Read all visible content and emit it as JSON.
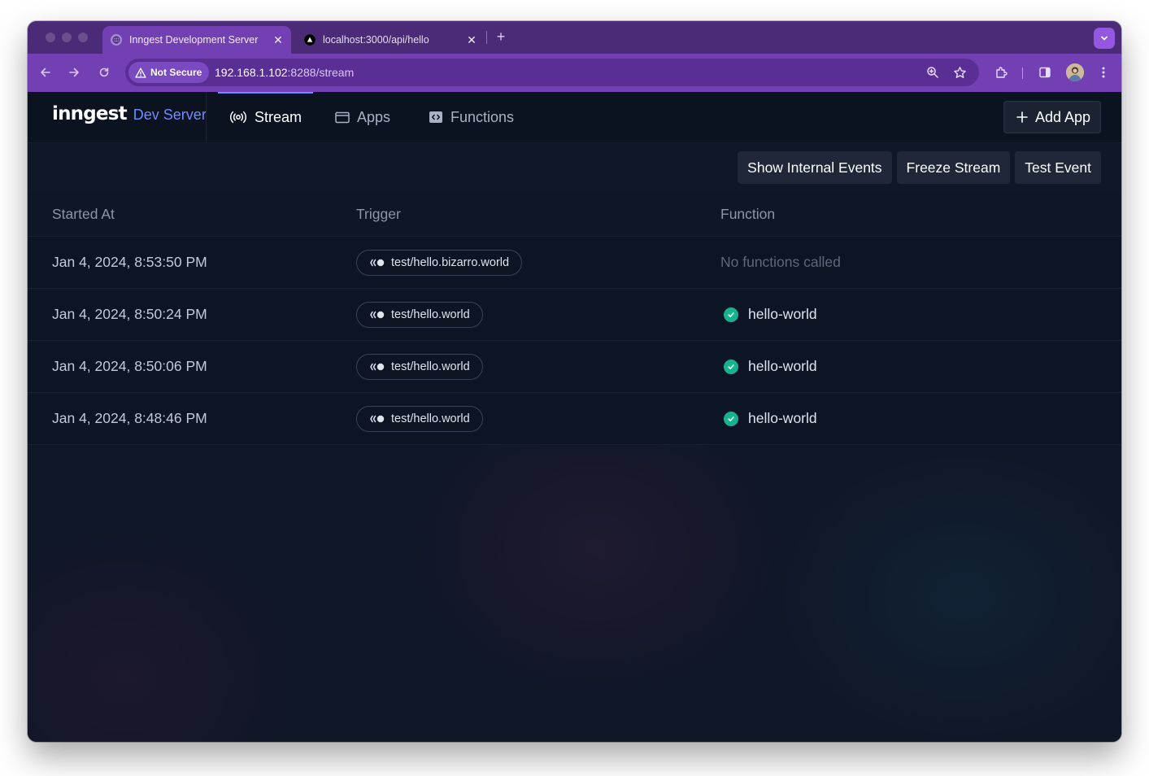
{
  "browser": {
    "tabs": [
      {
        "title": "Inngest Development Server",
        "active": true,
        "favicon": "globe-icon"
      },
      {
        "title": "localhost:3000/api/hello",
        "active": false,
        "favicon": "vercel-triangle-icon"
      }
    ],
    "security_label": "Not Secure",
    "url_host": "192.168.1.102",
    "url_path": ":8288/stream",
    "accent": "#7340b3"
  },
  "app": {
    "logo": "inngest",
    "product": "Dev Server",
    "nav": [
      {
        "label": "Stream",
        "icon": "broadcast-icon",
        "active": true
      },
      {
        "label": "Apps",
        "icon": "window-icon",
        "active": false
      },
      {
        "label": "Functions",
        "icon": "code-icon",
        "active": false
      }
    ],
    "add_app_label": "Add App",
    "actions": [
      "Show Internal Events",
      "Freeze Stream",
      "Test Event"
    ]
  },
  "stream_table": {
    "columns": [
      "Started At",
      "Trigger",
      "Function"
    ],
    "rows": [
      {
        "started_at": "Jan 4, 2024, 8:53:50 PM",
        "trigger": "test/hello.bizarro.world",
        "function": "No functions called",
        "status": "none"
      },
      {
        "started_at": "Jan 4, 2024, 8:50:24 PM",
        "trigger": "test/hello.world",
        "function": "hello-world",
        "status": "completed"
      },
      {
        "started_at": "Jan 4, 2024, 8:50:06 PM",
        "trigger": "test/hello.world",
        "function": "hello-world",
        "status": "completed"
      },
      {
        "started_at": "Jan 4, 2024, 8:48:46 PM",
        "trigger": "test/hello.world",
        "function": "hello-world",
        "status": "completed"
      }
    ],
    "status_color": "#17b28f"
  }
}
